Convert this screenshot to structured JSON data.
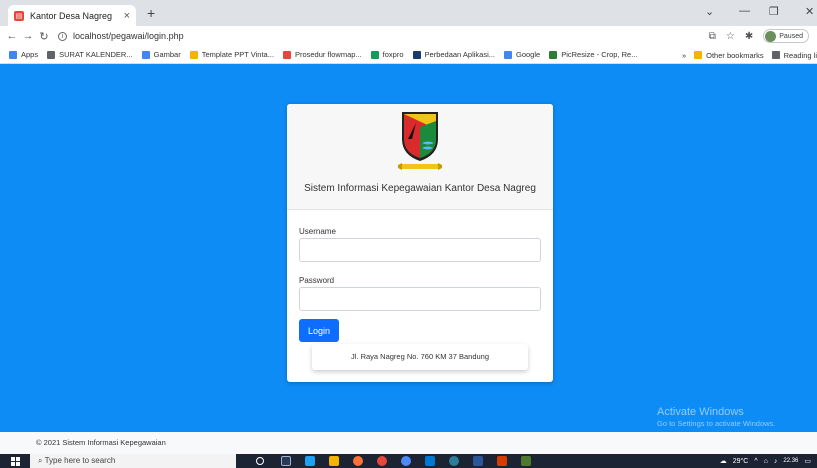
{
  "browser": {
    "tab_title": "Kantor Desa Nagreg",
    "tab_close": "×",
    "new_tab": "+",
    "url": "localhost/pegawai/login.php",
    "profile_status": "Paused",
    "bookmarks": [
      {
        "label": "Apps",
        "icon": "apps-grid-icon",
        "color": "#4285f4"
      },
      {
        "label": "SURAT KALENDER...",
        "icon": "globe-icon",
        "color": "#5f6368"
      },
      {
        "label": "Gambar",
        "icon": "google-icon",
        "color": "#4285f4"
      },
      {
        "label": "Template PPT Vinta...",
        "icon": "folder-icon",
        "color": "#f4b400"
      },
      {
        "label": "Prosedur flowmap...",
        "icon": "slides-icon",
        "color": "#e8453c"
      },
      {
        "label": "foxpro",
        "icon": "drive-icon",
        "color": "#0f9d58"
      },
      {
        "label": "Perbedaan Aplikasi...",
        "icon": "a-icon",
        "color": "#1a3a6e"
      },
      {
        "label": "Google",
        "icon": "google-icon",
        "color": "#4285f4"
      },
      {
        "label": "PicResize - Crop, Re...",
        "icon": "picresize-icon",
        "color": "#2e7d32"
      }
    ],
    "bookmarks_more": "»",
    "other_bookmarks": "Other bookmarks",
    "reading_list": "Reading li"
  },
  "login": {
    "title": "Sistem Informasi Kepegawaian Kantor Desa Nagreg",
    "username_label": "Username",
    "username_value": "",
    "password_label": "Password",
    "password_value": "",
    "submit_label": "Login",
    "address": "Jl. Raya Nagreg No. 760 KM 37 Bandung"
  },
  "activation": {
    "line1": "Activate Windows",
    "line2": "Go to Settings to activate Windows."
  },
  "footer": {
    "copyright": "© 2021 Sistem Informasi Kepegawaian"
  },
  "taskbar": {
    "search_placeholder": "Type here to search",
    "weather": "29°C",
    "time": "22.36"
  },
  "colors": {
    "page_background": "#0d8cf5",
    "button": "#0d6efd",
    "taskbar": "#1c2433"
  }
}
